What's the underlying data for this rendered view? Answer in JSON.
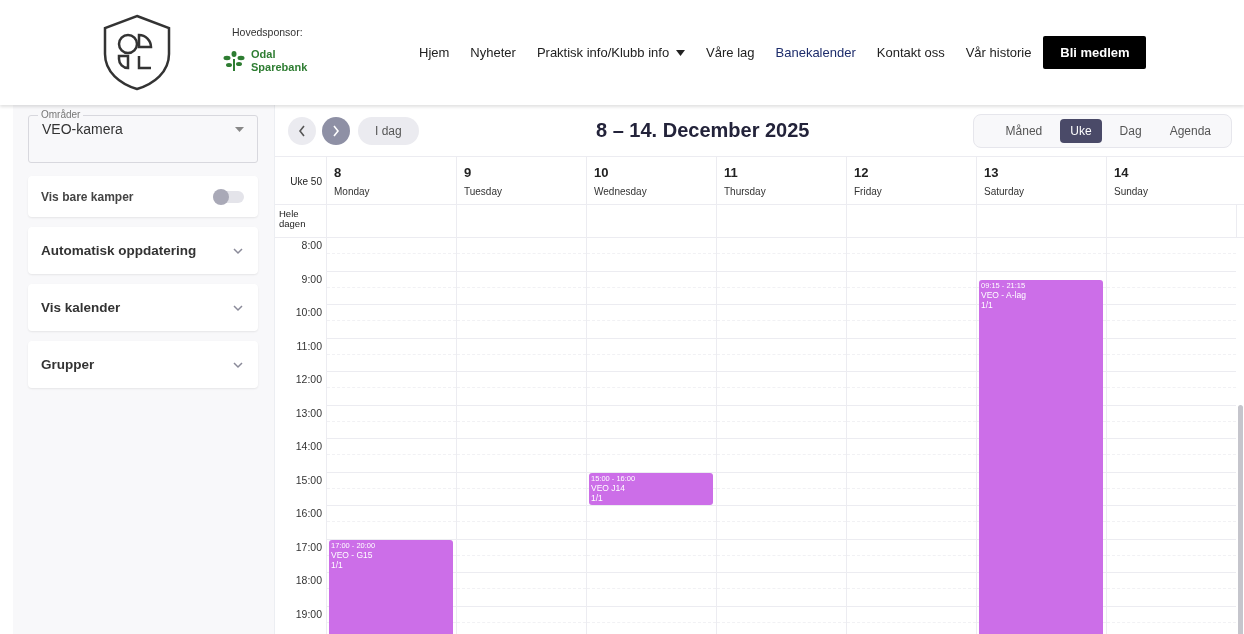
{
  "header": {
    "sponsor_label": "Hovedsponsor:",
    "sponsor_name": "Odal Sparebank",
    "nav": [
      {
        "label": "Hjem",
        "kind": "link",
        "selected": false
      },
      {
        "label": "Nyheter",
        "kind": "link",
        "selected": false
      },
      {
        "label": "Praktisk info/Klubb info",
        "kind": "dropdown",
        "selected": false
      },
      {
        "label": "Våre lag",
        "kind": "link",
        "selected": false
      },
      {
        "label": "Banekalender",
        "kind": "link",
        "selected": true
      },
      {
        "label": "Kontakt oss",
        "kind": "link",
        "selected": false
      },
      {
        "label": "Vår historie",
        "kind": "link",
        "selected": false
      }
    ],
    "cta": "Bli medlem"
  },
  "sidebar": {
    "select": {
      "label": "Områder",
      "value": "VEO-kamera"
    },
    "toggle": {
      "label": "Vis bare kamper",
      "on": false
    },
    "sections": [
      {
        "label": "Automatisk oppdatering",
        "expanded": false
      },
      {
        "label": "Vis kalender",
        "expanded": false
      },
      {
        "label": "Grupper",
        "expanded": false
      }
    ]
  },
  "calendar": {
    "nav_buttons": [
      {
        "kind": "prev",
        "active": false
      },
      {
        "kind": "next",
        "active": true
      }
    ],
    "today": "I dag",
    "title": "8 – 14. December 2025",
    "views": [
      {
        "label": "Måned",
        "selected": false
      },
      {
        "label": "Uke",
        "selected": true
      },
      {
        "label": "Dag",
        "selected": false
      },
      {
        "label": "Agenda",
        "selected": false
      }
    ],
    "week": "Uke 50",
    "all_day": "Hele dagen",
    "hours": [
      "8:00",
      "9:00",
      "10:00",
      "11:00",
      "12:00",
      "13:00",
      "14:00",
      "15:00",
      "16:00",
      "17:00",
      "18:00",
      "19:00"
    ],
    "days": [
      {
        "date": "8",
        "weekday": "Monday",
        "events": [
          {
            "time": "17:00 - 20:00",
            "title": "VEO - G15",
            "count": "1/1"
          }
        ]
      },
      {
        "date": "9",
        "weekday": "Tuesday"
      },
      {
        "date": "10",
        "weekday": "Wednesday",
        "events": [
          {
            "time": "15:00 - 16:00",
            "title": "VEO J14",
            "count": "1/1"
          }
        ]
      },
      {
        "date": "11",
        "weekday": "Thursday"
      },
      {
        "date": "12",
        "weekday": "Friday"
      },
      {
        "date": "13",
        "weekday": "Saturday",
        "events": [
          {
            "time": "09:15 - 21:15",
            "title": "VEO - A-lag",
            "count": "1/1"
          }
        ]
      },
      {
        "date": "14",
        "weekday": "Sunday"
      }
    ]
  }
}
